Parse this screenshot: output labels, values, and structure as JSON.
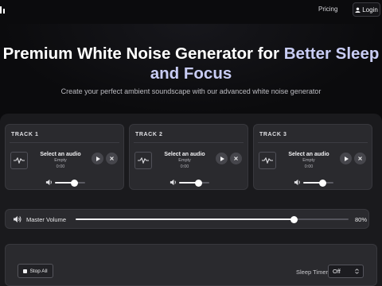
{
  "nav": {
    "pricing": "Pricing",
    "login": "Login"
  },
  "hero": {
    "title_part1": "Premium White Noise Generator for ",
    "title_highlight": "Better Sleep",
    "title_part2": "and Focus",
    "subtitle": "Create your perfect ambient soundscape with our advanced white noise generator"
  },
  "tracks": [
    {
      "label": "TRACK 1",
      "audio_title": "Select an audio",
      "status": "Empty",
      "time": "0:00",
      "volume": 0.65
    },
    {
      "label": "TRACK 2",
      "audio_title": "Select an audio",
      "status": "Empty",
      "time": "0:00",
      "volume": 0.65
    },
    {
      "label": "TRACK 3",
      "audio_title": "Select an audio",
      "status": "Empty",
      "time": "0:00",
      "volume": 0.65
    }
  ],
  "master": {
    "label": "Master Volume",
    "value_text": "80%",
    "volume": 0.8
  },
  "controls": {
    "stop_all": "Stop All",
    "sleep_timer_label": "Sleep Timer:",
    "sleep_timer_value": "Off"
  },
  "colors": {
    "background": "#0b0b0d",
    "panel": "#1a1a1d",
    "card": "#2a2a2e",
    "title_highlight": "#c9cdf5"
  }
}
